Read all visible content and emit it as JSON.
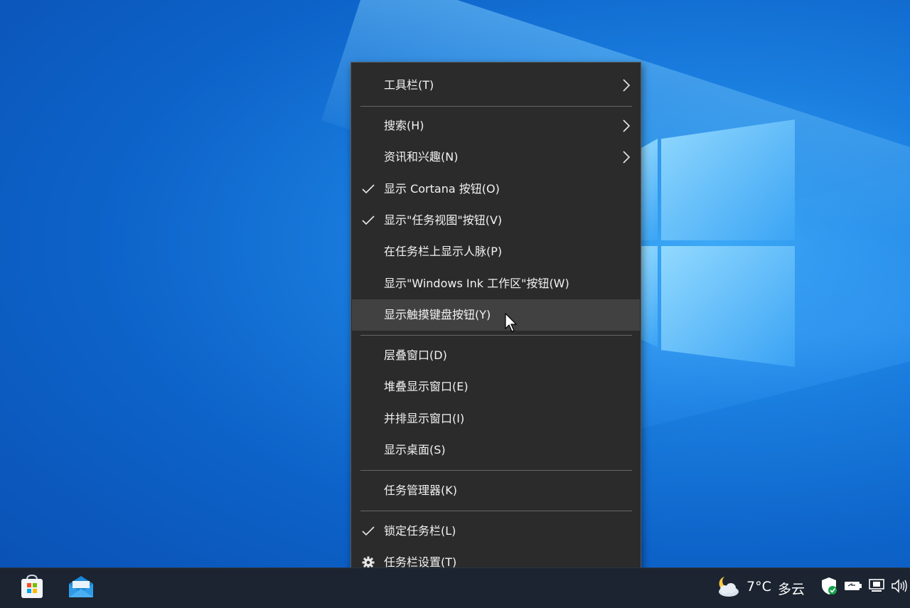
{
  "context_menu": {
    "items": [
      {
        "label": "工具栏(T)",
        "checked": false,
        "submenu": true
      },
      {
        "label": "搜索(H)",
        "checked": false,
        "submenu": true
      },
      {
        "label": "资讯和兴趣(N)",
        "checked": false,
        "submenu": true
      },
      {
        "label": "显示 Cortana 按钮(O)",
        "checked": true,
        "submenu": false
      },
      {
        "label": "显示\"任务视图\"按钮(V)",
        "checked": true,
        "submenu": false
      },
      {
        "label": "在任务栏上显示人脉(P)",
        "checked": false,
        "submenu": false
      },
      {
        "label": "显示\"Windows Ink 工作区\"按钮(W)",
        "checked": false,
        "submenu": false
      },
      {
        "label": "显示触摸键盘按钮(Y)",
        "checked": false,
        "submenu": false,
        "hovered": true
      },
      {
        "label": "层叠窗口(D)",
        "checked": false,
        "submenu": false
      },
      {
        "label": "堆叠显示窗口(E)",
        "checked": false,
        "submenu": false
      },
      {
        "label": "并排显示窗口(I)",
        "checked": false,
        "submenu": false
      },
      {
        "label": "显示桌面(S)",
        "checked": false,
        "submenu": false
      },
      {
        "label": "任务管理器(K)",
        "checked": false,
        "submenu": false
      },
      {
        "label": "锁定任务栏(L)",
        "checked": true,
        "submenu": false
      },
      {
        "label": "任务栏设置(T)",
        "checked": false,
        "submenu": false,
        "icon": "gear-icon"
      }
    ]
  },
  "taskbar": {
    "pinned": [
      {
        "icon": "microsoft-store-icon"
      },
      {
        "icon": "mail-icon"
      }
    ],
    "weather": {
      "icon": "partly-cloudy-night-icon",
      "temperature": "7°C",
      "condition": "多云"
    },
    "tray": [
      "windows-security-icon",
      "battery-icon",
      "network-icon",
      "volume-icon"
    ]
  },
  "colors": {
    "menu_bg": "#2b2b2b",
    "menu_hover": "#414141",
    "menu_text": "#f2f2f2",
    "taskbar_bg": "#1c2431",
    "desktop_blue": "#0d63c9"
  }
}
